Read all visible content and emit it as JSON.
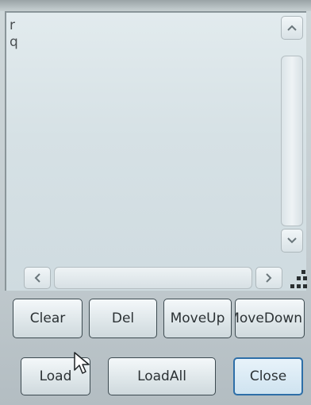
{
  "list": {
    "items": [
      "r",
      "q"
    ]
  },
  "scrollbar": {
    "up_icon": "chevron-up-icon",
    "down_icon": "chevron-down-icon",
    "left_icon": "chevron-left-icon",
    "right_icon": "chevron-right-icon"
  },
  "buttons": {
    "clear": "Clear",
    "del": "Del",
    "move_up": "MoveUp",
    "move_down": "MoveDown",
    "load": "Load",
    "load_all": "LoadAll",
    "close": "Close"
  },
  "colors": {
    "focus_border": "#2e6fa8",
    "button_border": "#3c4a50",
    "list_background": "#d6e1e5"
  }
}
